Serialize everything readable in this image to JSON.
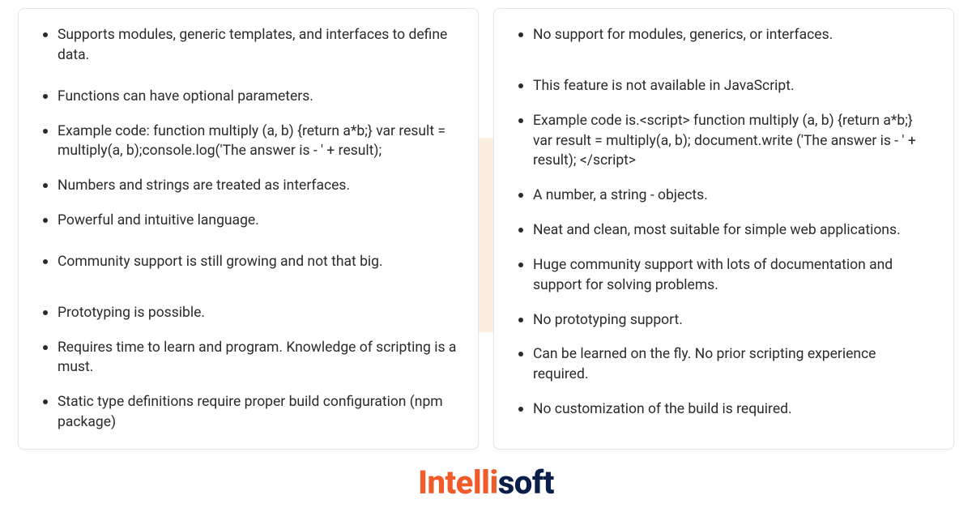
{
  "left_card": {
    "items": [
      "Supports modules, generic templates, and interfaces to define data.",
      "Functions can have optional parameters.",
      "Example code: function multiply (a, b) {return a*b;} var result = multiply(a, b);console.log('The answer is - ' + result);",
      "Numbers and strings are treated as interfaces.",
      "Powerful and intuitive language.",
      "Community support is still growing and not that big.",
      "Prototyping is possible.",
      "Requires time to learn and program. Knowledge of scripting is a must.",
      "Static type definitions require proper build configuration (npm package)"
    ]
  },
  "right_card": {
    "items": [
      "No support for modules, generics, or interfaces.",
      "This feature is not available in JavaScript.",
      "Example code is.<script> function multiply (a, b) {return a*b;} var result = multiply(a, b); document.write ('The answer is - ' + result); </script>",
      "A number, a string - objects.",
      "Neat and clean, most suitable for simple web applications.",
      "Huge community support with lots of documentation and support for solving problems.",
      "No prototyping support.",
      "Can be learned on the fly. No prior scripting experience required.",
      "No customization of the build is required."
    ]
  },
  "logo": {
    "part1": "Intelli",
    "part2": "soft"
  },
  "colors": {
    "accent_orange": "#f15a29",
    "accent_navy": "#0a1e4a",
    "bg_peach": "#fae3cc"
  }
}
